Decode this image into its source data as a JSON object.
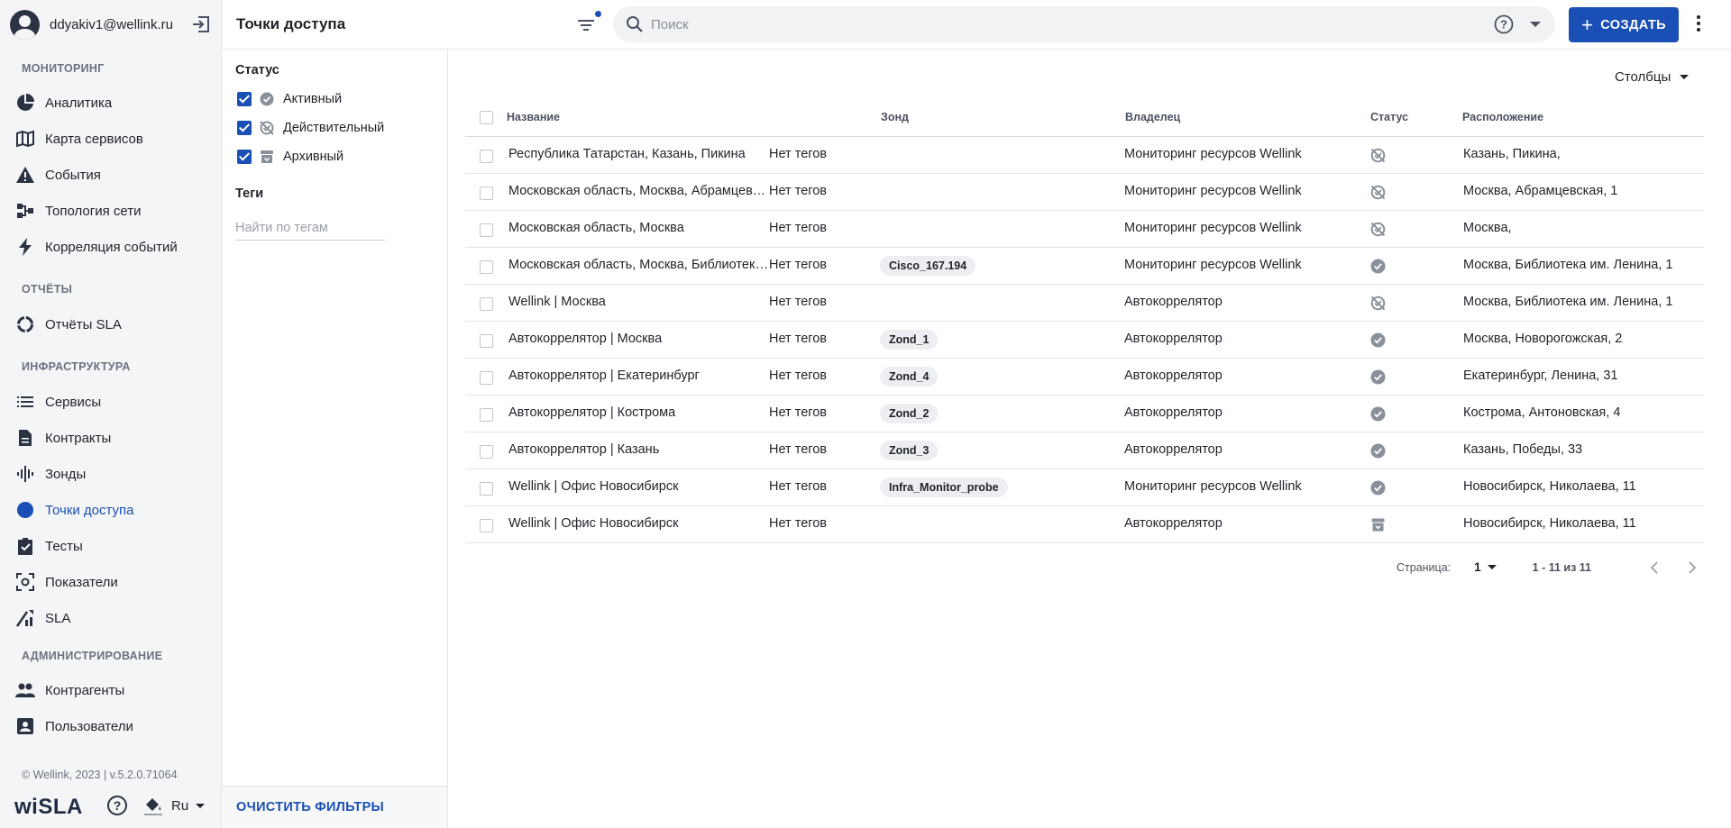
{
  "user": {
    "email": "ddyakiv1@wellink.ru"
  },
  "sidebar": {
    "sections": [
      {
        "title": "МОНИТОРИНГ"
      },
      {
        "title": "ОТЧЁТЫ"
      },
      {
        "title": "ИНФРАСТРУКТУРА"
      },
      {
        "title": "АДМИНИСТРИРОВАНИЕ"
      }
    ],
    "items": [
      {
        "label": "Аналитика",
        "icon": "pie-chart-icon"
      },
      {
        "label": "Карта сервисов",
        "icon": "map-icon"
      },
      {
        "label": "События",
        "icon": "warning-icon"
      },
      {
        "label": "Топология сети",
        "icon": "topology-icon"
      },
      {
        "label": "Корреляция событий",
        "icon": "lightning-icon"
      },
      {
        "label": "Отчёты SLA",
        "icon": "donut-icon"
      },
      {
        "label": "Сервисы",
        "icon": "list-icon"
      },
      {
        "label": "Контракты",
        "icon": "document-icon"
      },
      {
        "label": "Зонды",
        "icon": "probe-icon"
      },
      {
        "label": "Точки доступа",
        "icon": "dot-icon",
        "active": true
      },
      {
        "label": "Тесты",
        "icon": "clipboard-check-icon"
      },
      {
        "label": "Показатели",
        "icon": "metrics-icon"
      },
      {
        "label": "SLA",
        "icon": "sla-icon"
      },
      {
        "label": "Контрагенты",
        "icon": "people-icon"
      },
      {
        "label": "Пользователи",
        "icon": "user-card-icon"
      }
    ],
    "footer_text": "© Wellink, 2023 | v.5.2.0.71064",
    "logo": "wiSLA",
    "language": "Ru"
  },
  "header": {
    "title": "Точки доступа",
    "search_placeholder": "Поиск",
    "create_label": "СОЗДАТЬ"
  },
  "filters": {
    "status_title": "Статус",
    "statuses": [
      {
        "label": "Активный",
        "checked": true
      },
      {
        "label": "Действительный",
        "checked": true
      },
      {
        "label": "Архивный",
        "checked": true
      }
    ],
    "tags_title": "Теги",
    "tags_placeholder": "Найти по тегам",
    "clear_label": "ОЧИСТИТЬ ФИЛЬТРЫ"
  },
  "table": {
    "columns_button": "Столбцы",
    "headers": {
      "name": "Название",
      "probe": "Зонд",
      "owner": "Владелец",
      "status": "Статус",
      "location": "Расположение"
    },
    "rows": [
      {
        "name": "Республика Татарстан, Казань, Пикина",
        "tags": "Нет тегов",
        "probe": "",
        "owner": "Мониторинг ресурсов Wellink",
        "status": "valid",
        "location": "Казань, Пикина,"
      },
      {
        "name": "Московская область, Москва, Абрамцевская",
        "tags": "Нет тегов",
        "probe": "",
        "owner": "Мониторинг ресурсов Wellink",
        "status": "valid",
        "location": "Москва, Абрамцевская, 1"
      },
      {
        "name": "Московская область, Москва",
        "tags": "Нет тегов",
        "probe": "",
        "owner": "Мониторинг ресурсов Wellink",
        "status": "valid",
        "location": "Москва,"
      },
      {
        "name": "Московская область, Москва, Библиотека им. Ленина",
        "tags": "Нет тегов",
        "probe": "Cisco_167.194",
        "owner": "Мониторинг ресурсов Wellink",
        "status": "active",
        "location": "Москва, Библиотека им. Ленина, 1"
      },
      {
        "name": "Wellink | Москва",
        "tags": "Нет тегов",
        "probe": "",
        "owner": "Автокоррелятор",
        "status": "valid",
        "location": "Москва, Библиотека им. Ленина, 1"
      },
      {
        "name": "Автокоррелятор | Москва",
        "tags": "Нет тегов",
        "probe": "Zond_1",
        "owner": "Автокоррелятор",
        "status": "active",
        "location": "Москва, Новорогожская, 2"
      },
      {
        "name": "Автокоррелятор | Екатеринбург",
        "tags": "Нет тегов",
        "probe": "Zond_4",
        "owner": "Автокоррелятор",
        "status": "active",
        "location": "Екатеринбург, Ленина, 31"
      },
      {
        "name": "Автокоррелятор | Кострома",
        "tags": "Нет тегов",
        "probe": "Zond_2",
        "owner": "Автокоррелятор",
        "status": "active",
        "location": "Кострома, Антоновская, 4"
      },
      {
        "name": "Автокоррелятор | Казань",
        "tags": "Нет тегов",
        "probe": "Zond_3",
        "owner": "Автокоррелятор",
        "status": "active",
        "location": "Казань, Победы, 33"
      },
      {
        "name": "Wellink | Офис Новосибирск",
        "tags": "Нет тегов",
        "probe": "Infra_Monitor_probe",
        "owner": "Мониторинг ресурсов Wellink",
        "status": "active",
        "location": "Новосибирск, Николаева, 11"
      },
      {
        "name": "Wellink | Офис Новосибирск",
        "tags": "Нет тегов",
        "probe": "",
        "owner": "Автокоррелятор",
        "status": "archived",
        "location": "Новосибирск, Николаева, 11"
      }
    ]
  },
  "pagination": {
    "page_label": "Страница:",
    "page": "1",
    "range": "1 - 11 из 11"
  },
  "colors": {
    "accent": "#1a4fb5",
    "sidebar_bg": "#f4f5f7",
    "status_icon": "#8a9099"
  }
}
